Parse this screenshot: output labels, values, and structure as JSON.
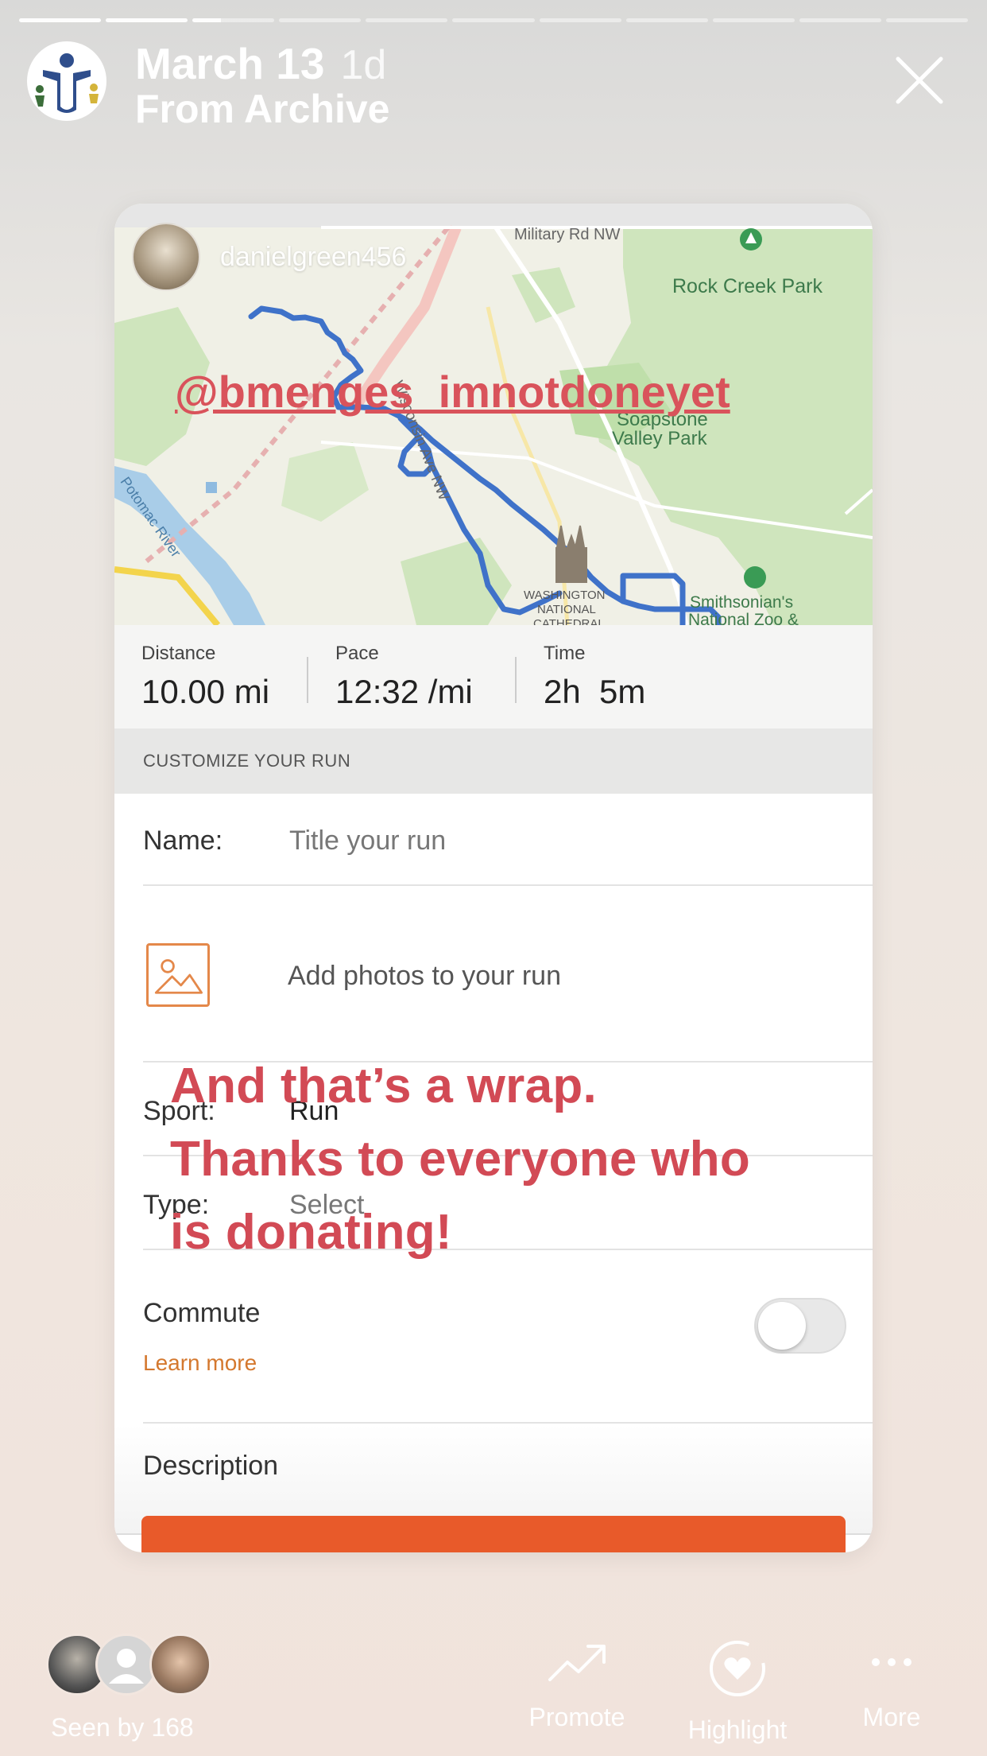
{
  "story": {
    "date": "March 13",
    "age": "1d",
    "source": "From Archive",
    "segments_total": 11,
    "segments_done": 2,
    "current_segment_progress": 0.35
  },
  "card": {
    "map": {
      "username": "danielgreen456",
      "mention": "@bmenges_imnotdoneyet",
      "labels": {
        "military_rd": "Military Rd NW",
        "rock_creek": "Rock Creek Park",
        "soapstone": "Soapstone",
        "valley_park": "Valley Park",
        "wisconsin": "Wisconsin Ave NW",
        "potomac": "Potomac River",
        "cathedral_1": "WASHINGTON",
        "cathedral_2": "NATIONAL",
        "cathedral_3": "CATHEDRAL",
        "zoo_1": "Smithsonian's",
        "zoo_2": "National Zoo &"
      }
    },
    "stats": [
      {
        "label": "Distance",
        "value": "10.00 mi"
      },
      {
        "label": "Pace",
        "value": "12:32 /mi"
      },
      {
        "label": "Time",
        "value": "2h  5m"
      }
    ],
    "section_title": "CUSTOMIZE YOUR RUN",
    "name_label": "Name:",
    "name_placeholder": "Title your run",
    "add_photos": "Add photos to your run",
    "sport_label": "Sport:",
    "sport_value": "Run",
    "type_label": "Type:",
    "type_value": "Select",
    "commute_label": "Commute",
    "learn_more": "Learn more",
    "description_label": "Description",
    "overlay_lines": [
      "And that’s a wrap.",
      "Thanks to everyone who",
      "is donating!"
    ]
  },
  "footer": {
    "seen_by": "Seen by 168",
    "actions": [
      {
        "label": "Promote",
        "icon": "trend-up-icon"
      },
      {
        "label": "Highlight",
        "icon": "heart-circle-icon"
      },
      {
        "label": "More",
        "icon": "ellipsis-icon"
      }
    ]
  },
  "colors": {
    "route": "#3f72c9",
    "overlay_text": "#d24a55",
    "accent_orange": "#e85a2a"
  }
}
